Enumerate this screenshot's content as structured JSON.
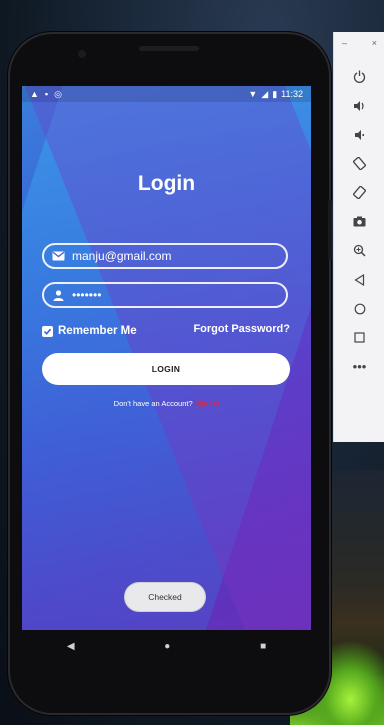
{
  "status_bar": {
    "time": "11:32",
    "left_icons": [
      "warning-icon",
      "sd-card-icon",
      "sync-icon"
    ],
    "right_icons": [
      "wifi-icon",
      "signal-icon",
      "battery-icon"
    ]
  },
  "login": {
    "title": "Login",
    "email_value": "manju@gmail.com",
    "password_value": "•••••••",
    "remember_label": "Remember Me",
    "remember_checked": true,
    "forgot_label": "Forgot Password?",
    "login_button": "LOGIN",
    "no_account_text": "Don't have an Account?",
    "signup_label": "Sign Up"
  },
  "toast": {
    "text": "Checked"
  },
  "nav": [
    "back-icon",
    "home-icon",
    "recents-icon"
  ],
  "emulator_toolbar": {
    "window_controls": [
      "minimize",
      "close"
    ],
    "buttons": [
      "power-icon",
      "volume-up-icon",
      "volume-down-icon",
      "rotate-left-icon",
      "rotate-right-icon",
      "camera-icon",
      "zoom-icon",
      "back-icon",
      "home-icon",
      "overview-icon",
      "more-icon"
    ]
  },
  "colors": {
    "accent_link": "#e0243a",
    "screen_gradient_start": "#3b7fdc",
    "screen_gradient_end": "#6430b8"
  }
}
